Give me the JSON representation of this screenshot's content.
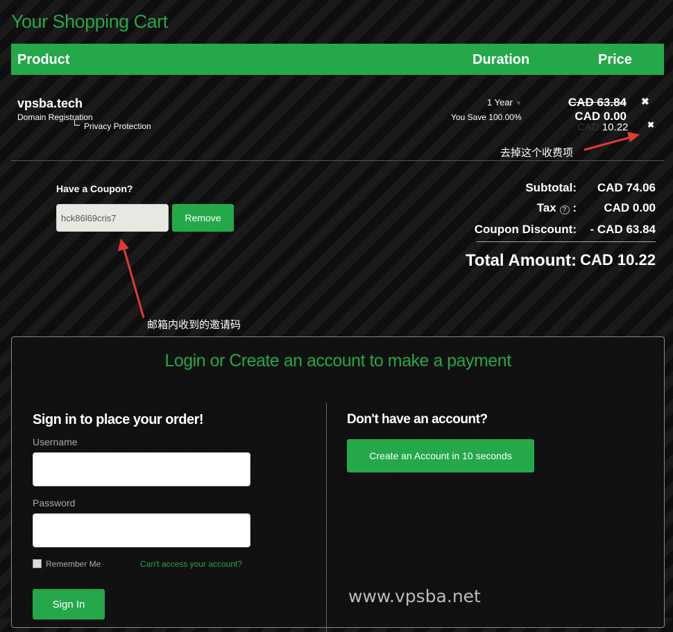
{
  "cart": {
    "title": "Your Shopping Cart",
    "headers": {
      "product": "Product",
      "duration": "Duration",
      "price": "Price"
    },
    "item": {
      "name": "vpsba.tech",
      "type": "Domain Registration",
      "addon": "Privacy Protection",
      "duration": "1 Year",
      "savings": "You Save 100.00%",
      "original_price": "CAD 63.84",
      "price": "CAD 0.00",
      "addon_currency": "CAD",
      "addon_price": "10.22"
    },
    "annotation_remove": "去掉这个收费项"
  },
  "coupon": {
    "label": "Have a Coupon?",
    "code": "hck86l69cris7",
    "remove": "Remove",
    "annotation": "邮箱内收到的邀请码"
  },
  "totals": {
    "subtotal_label": "Subtotal:",
    "subtotal": "CAD 74.06",
    "tax_label": "Tax",
    "tax": "CAD 0.00",
    "discount_label": "Coupon Discount:",
    "discount": "- CAD 63.84",
    "total_label": "Total Amount:",
    "total": "CAD 10.22"
  },
  "login": {
    "heading": "Login or Create an account to make a payment",
    "signin_title": "Sign in to place your order!",
    "username_label": "Username",
    "username": "",
    "password_label": "Password",
    "password": "",
    "remember": "Remember Me",
    "forgot": "Can't access your account?",
    "signin": "Sign In",
    "no_account": "Don't have an account?",
    "create": "Create an Account in 10 seconds"
  },
  "watermark": "www.vpsba.net",
  "colors": {
    "accent": "#24a84a",
    "annotation_arrow": "#e53935"
  }
}
